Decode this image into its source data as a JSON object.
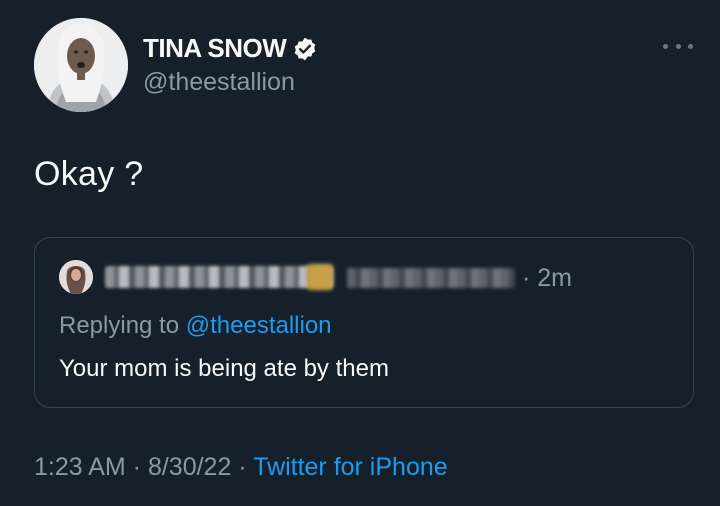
{
  "tweet": {
    "author_name": "TINA SNOW",
    "handle": "@theestallion",
    "text": "Okay ?",
    "quote": {
      "time": "· 2m",
      "replying_prefix": "Replying to ",
      "replying_handle": "@theestallion",
      "text": "Your mom is being ate by them"
    },
    "timestamp": "1:23 AM · 8/30/22 · ",
    "source": "Twitter for iPhone"
  },
  "colors": {
    "background": "#15202b",
    "accent": "#1d9bf0",
    "secondary_text": "#8b98a5",
    "border": "#38444d"
  },
  "icons": [
    "verified-icon",
    "more-icon"
  ]
}
